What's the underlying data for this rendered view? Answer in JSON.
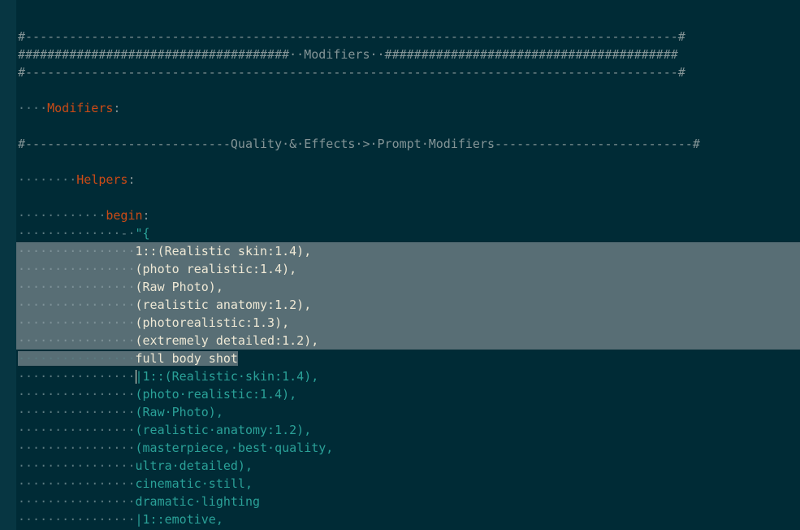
{
  "editor": {
    "colors": {
      "background": "#002b36",
      "gutter": "#073642",
      "key": "#cb4b16",
      "string": "#2aa198",
      "selection": "#586e75"
    },
    "lines": [
      {
        "ws": "",
        "text": "#-----------------------------------------------------------------------------------------#"
      },
      {
        "ws": "",
        "text": "#####################################··Modifiers··########################################"
      },
      {
        "ws": "",
        "text": "#-----------------------------------------------------------------------------------------#"
      },
      {
        "ws": "",
        "text": ""
      },
      {
        "ws": "····",
        "key": "Modifiers",
        "punct": ":"
      },
      {
        "ws": "",
        "text": ""
      },
      {
        "ws": "",
        "text": "#----------------------------Quality·&·Effects·>·Prompt·Modifiers---------------------------#"
      },
      {
        "ws": "",
        "text": ""
      },
      {
        "ws": "········",
        "key": "Helpers",
        "punct": ":"
      },
      {
        "ws": "",
        "text": ""
      },
      {
        "ws": "············",
        "key": "begin",
        "punct": ":"
      },
      {
        "ws": "··············-·",
        "str": "\"{"
      },
      {
        "ws": "················",
        "str": "1::(Realistic skin:1.4),"
      },
      {
        "ws": "················",
        "str": "(photo realistic:1.4),"
      },
      {
        "ws": "················",
        "str": "(Raw Photo),"
      },
      {
        "ws": "················",
        "str": "(realistic anatomy:1.2),"
      },
      {
        "ws": "················",
        "str": "(photorealistic:1.3),"
      },
      {
        "ws": "················",
        "str": "(extremely detailed:1.2),"
      },
      {
        "ws": "················",
        "str": "full body shot"
      },
      {
        "ws": "················",
        "str": "|1::(Realistic·skin:1.4),"
      },
      {
        "ws": "················",
        "str": "(photo·realistic:1.4),"
      },
      {
        "ws": "················",
        "str": "(Raw·Photo),"
      },
      {
        "ws": "················",
        "str": "(realistic·anatomy:1.2),"
      },
      {
        "ws": "················",
        "str": "(masterpiece,·best·quality,"
      },
      {
        "ws": "················",
        "str": "ultra·detailed),"
      },
      {
        "ws": "················",
        "str": "cinematic·still,"
      },
      {
        "ws": "················",
        "str": "dramatic·lighting"
      },
      {
        "ws": "················",
        "str": "|1::emotive,"
      }
    ]
  }
}
